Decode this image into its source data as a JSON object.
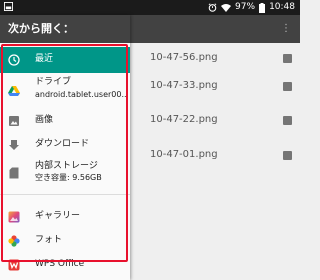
{
  "status_bar": {
    "battery": "97%",
    "time": "10:48"
  },
  "drawer": {
    "title": "次から開く：",
    "items": [
      {
        "label": "最近",
        "icon": "clock-icon",
        "active": true
      },
      {
        "label": "ドライブ",
        "sub": "android.tablet.user00...",
        "icon": "google-drive-icon"
      },
      {
        "label": "画像",
        "icon": "image-icon"
      },
      {
        "label": "ダウンロード",
        "icon": "download-icon"
      },
      {
        "label": "内部ストレージ",
        "sub": "空き容量: 9.56GB",
        "icon": "sd-card-icon"
      }
    ],
    "apps": [
      {
        "label": "ギャラリー",
        "icon": "gallery-icon"
      },
      {
        "label": "フォト",
        "icon": "google-photos-icon"
      },
      {
        "label": "WPS Office",
        "icon": "wps-office-icon"
      }
    ]
  },
  "background_list": {
    "files": [
      "10-47-56.png",
      "10-47-33.png",
      "10-47-22.png",
      "10-47-01.png"
    ]
  },
  "colors": {
    "accent": "#009688",
    "toolbar": "#424242",
    "highlight": "#e8112d"
  }
}
